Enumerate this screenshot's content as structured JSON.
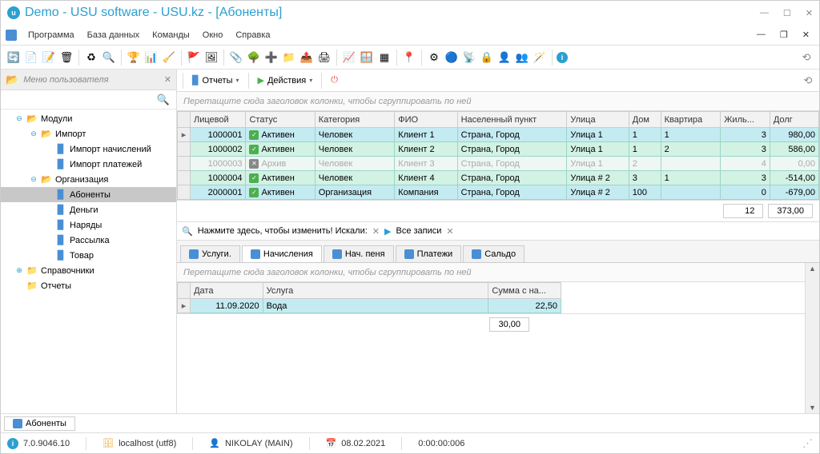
{
  "title": "Demo - USU software - USU.kz - [Абоненты]",
  "menu": [
    "Программа",
    "База данных",
    "Команды",
    "Окно",
    "Справка"
  ],
  "sidebar": {
    "header": "Меню пользователя",
    "items": {
      "modules": "Модули",
      "import": "Импорт",
      "import_charges": "Импорт начислений",
      "import_payments": "Импорт платежей",
      "organization": "Организация",
      "subscribers": "Абоненты",
      "money": "Деньги",
      "orders": "Наряды",
      "mailing": "Рассылка",
      "goods": "Товар",
      "refs": "Справочники",
      "reports": "Отчеты"
    }
  },
  "content_toolbar": {
    "reports": "Отчеты",
    "actions": "Действия"
  },
  "group_hint": "Перетащите сюда заголовок колонки, чтобы сгруппировать по ней",
  "grid": {
    "cols": [
      "Лицевой",
      "Статус",
      "Категория",
      "ФИО",
      "Населенный пункт",
      "Улица",
      "Дом",
      "Квартира",
      "Жиль...",
      "Долг"
    ],
    "rows": [
      {
        "account": "1000001",
        "status": "Активен",
        "active": true,
        "cat": "Человек",
        "fio": "Клиент 1",
        "city": "Страна, Город",
        "street": "Улица 1",
        "house": "1",
        "flat": "1",
        "res": "3",
        "debt": "980,00",
        "sel": true
      },
      {
        "account": "1000002",
        "status": "Активен",
        "active": true,
        "cat": "Человек",
        "fio": "Клиент 2",
        "city": "Страна, Город",
        "street": "Улица 1",
        "house": "1",
        "flat": "2",
        "res": "3",
        "debt": "586,00"
      },
      {
        "account": "1000003",
        "status": "Архив",
        "active": false,
        "cat": "Человек",
        "fio": "Клиент 3",
        "city": "Страна, Город",
        "street": "Улица 1",
        "house": "2",
        "flat": "",
        "res": "4",
        "debt": "0,00",
        "archived": true
      },
      {
        "account": "1000004",
        "status": "Активен",
        "active": true,
        "cat": "Человек",
        "fio": "Клиент 4",
        "city": "Страна, Город",
        "street": "Улица # 2",
        "house": "3",
        "flat": "1",
        "res": "3",
        "debt": "-514,00"
      },
      {
        "account": "2000001",
        "status": "Активен",
        "active": true,
        "cat": "Организация",
        "fio": "Компания",
        "city": "Страна, Город",
        "street": "Улица # 2",
        "house": "100",
        "flat": "",
        "res": "0",
        "debt": "-679,00"
      }
    ],
    "footer_count": "12",
    "footer_sum": "373,00"
  },
  "search_bar": {
    "hint": "Нажмите здесь, чтобы изменить! Искали:",
    "filter": "Все записи"
  },
  "subtabs": [
    "Услуги.",
    "Начисления",
    "Нач. пеня",
    "Платежи",
    "Сальдо"
  ],
  "subtab_active": 1,
  "detail": {
    "cols": [
      "Дата",
      "Услуга",
      "Сумма с на..."
    ],
    "row": {
      "date": "11.09.2020",
      "service": "Вода",
      "sum": "22,50"
    },
    "footer_sum": "30,00"
  },
  "bottom_tab": "Абоненты",
  "status": {
    "version": "7.0.9046.10",
    "host": "localhost (utf8)",
    "user": "NIKOLAY (MAIN)",
    "date": "08.02.2021",
    "time": "0:00:00:006"
  }
}
